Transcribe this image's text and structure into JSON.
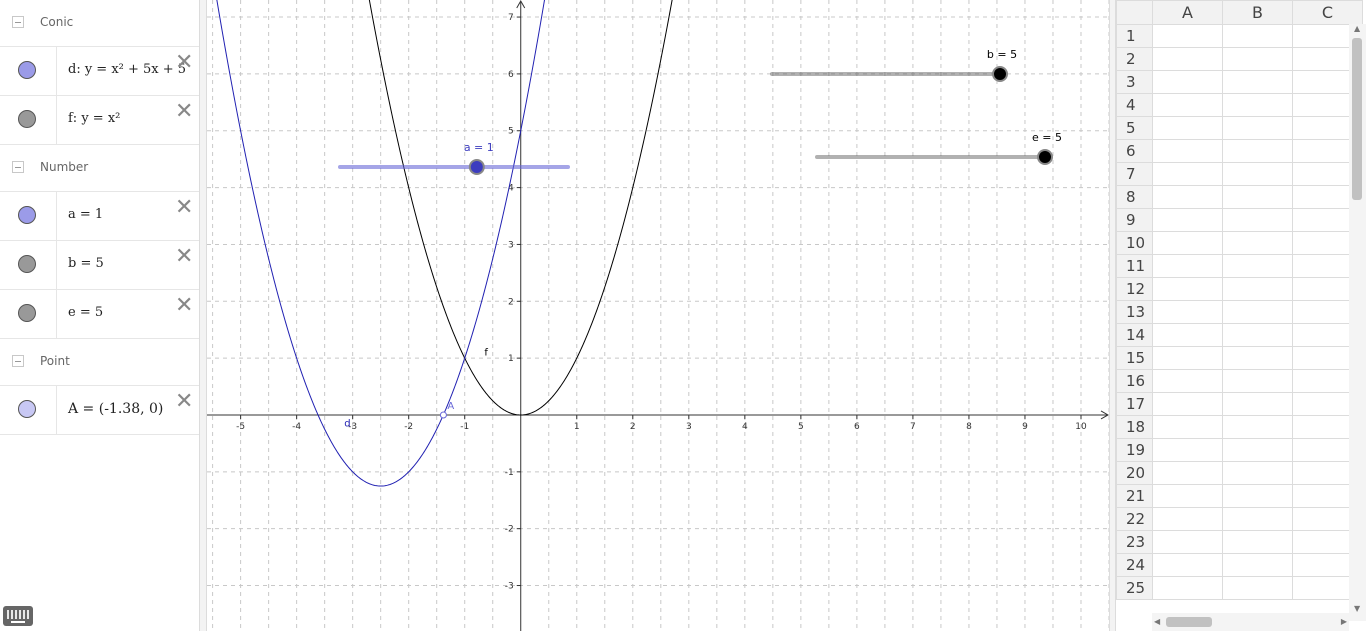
{
  "algebra": {
    "categories": [
      {
        "name": "Conic"
      },
      {
        "name": "Number"
      },
      {
        "name": "Point"
      }
    ],
    "items": {
      "d": {
        "expr": "d: y = x² + 5x + 5",
        "color": "#9b9be8"
      },
      "f": {
        "expr": "f: y = x²",
        "color": "#999999"
      },
      "a": {
        "expr": "a = 1",
        "color": "#9b9be8"
      },
      "b": {
        "expr": "b = 5",
        "color": "#999999"
      },
      "e": {
        "expr": "e = 5",
        "color": "#999999"
      },
      "A": {
        "expr": "A = (-1.38, 0)",
        "color": "#c8c8f4"
      }
    }
  },
  "graphics": {
    "x_ticks": [
      "-5",
      "-4",
      "-3",
      "-2",
      "-1",
      "1",
      "2",
      "3",
      "4",
      "5",
      "6",
      "7",
      "8",
      "9",
      "10"
    ],
    "y_ticks": [
      "-3",
      "-2",
      "-1",
      "1",
      "2",
      "3",
      "4",
      "5",
      "6",
      "7"
    ],
    "x_range": [
      -5.6,
      10.5
    ],
    "y_range": [
      -3.8,
      7.3
    ],
    "curve_d": {
      "a": 1,
      "b": 5,
      "c": 5,
      "label": "d",
      "color": "#2121b2"
    },
    "curve_f": {
      "a": 1,
      "b": 0,
      "c": 0,
      "label": "f",
      "color": "#000000"
    },
    "point_A": {
      "x": -1.38,
      "y": 0,
      "label": "A",
      "color": "#6868d8"
    },
    "sliders": {
      "a": {
        "label": "a = 1",
        "value": 1,
        "min": -5,
        "max": 5,
        "color": "#3d3dbf"
      },
      "b": {
        "label": "b = 5",
        "value": 5,
        "min": -5,
        "max": 5,
        "color": "#000000"
      },
      "e": {
        "label": "e = 5",
        "value": 5,
        "min": -5,
        "max": 5,
        "color": "#000000"
      }
    }
  },
  "spreadsheet": {
    "columns": [
      "A",
      "B",
      "C"
    ],
    "rows": [
      "1",
      "2",
      "3",
      "4",
      "5",
      "6",
      "7",
      "8",
      "9",
      "10",
      "11",
      "12",
      "13",
      "14",
      "15",
      "16",
      "17",
      "18",
      "19",
      "20",
      "21",
      "22",
      "23",
      "24",
      "25"
    ]
  }
}
